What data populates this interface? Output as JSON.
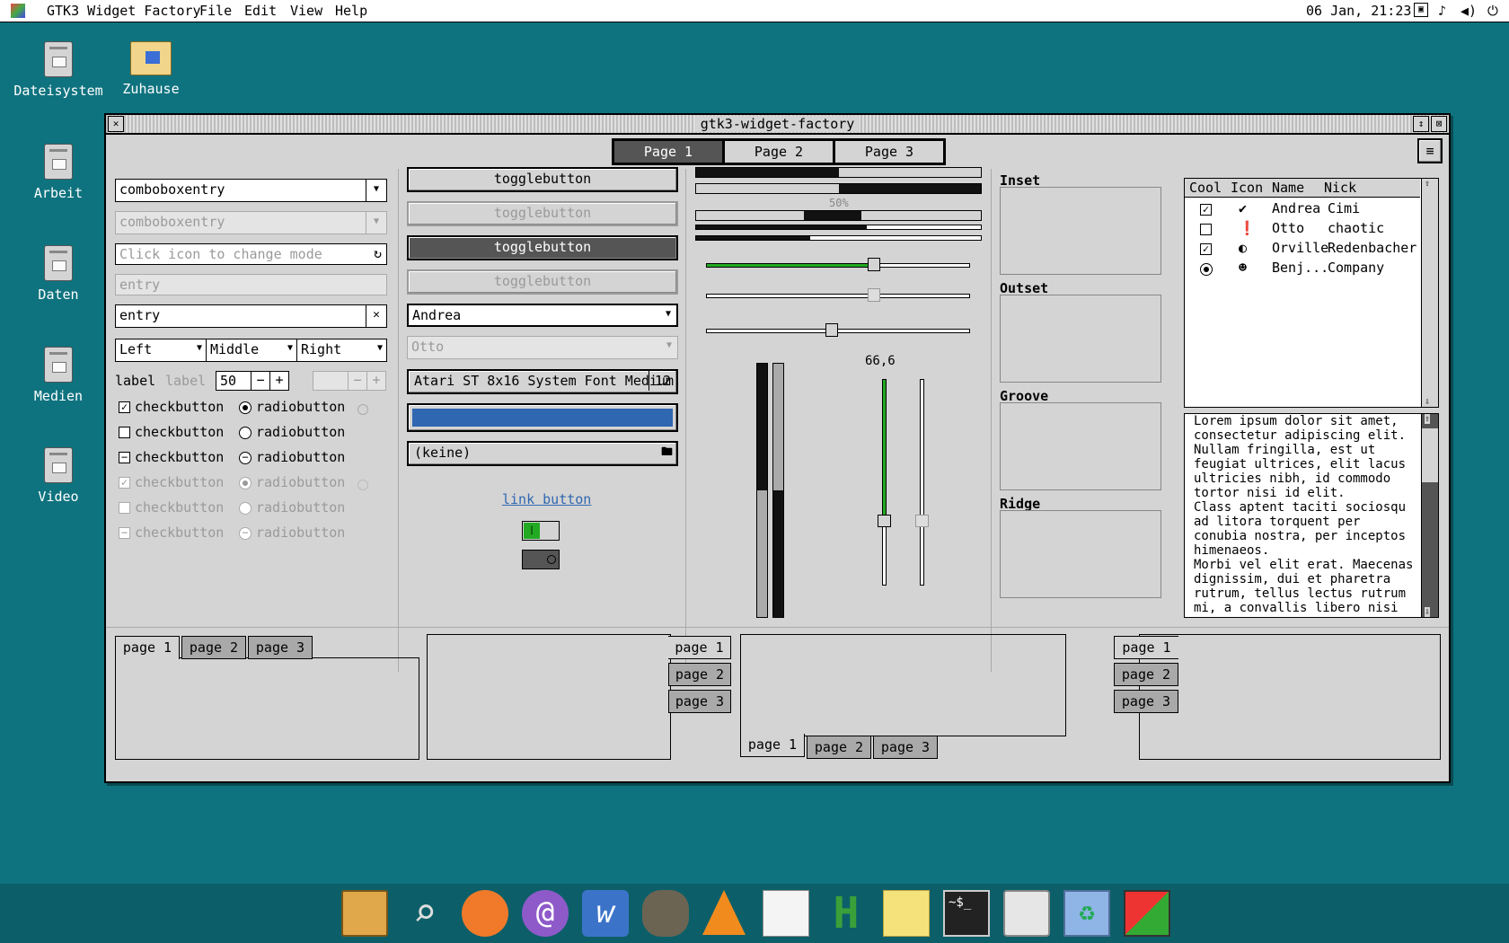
{
  "menubar": {
    "app_name": "GTK3 Widget Factory",
    "menus": [
      "File",
      "Edit",
      "View",
      "Help"
    ],
    "clock": "06 Jan, 21:23"
  },
  "desktop_icons": [
    "Dateisystem",
    "Zuhause",
    "Arbeit",
    "Daten",
    "Medien",
    "Video"
  ],
  "window": {
    "title": "gtk3-widget-factory",
    "page_tabs": [
      "Page 1",
      "Page 2",
      "Page 3"
    ],
    "col1": {
      "combo1": "comboboxentry",
      "combo2": "comboboxentry",
      "entry_icon_placeholder": "Click icon to change mode",
      "entry_disabled": "entry",
      "entry_clear": "entry",
      "seg": [
        "Left",
        "Middle",
        "Right"
      ],
      "label1": "label",
      "label2": "label",
      "spin_value": "50",
      "check_label": "checkbutton",
      "radio_label": "radiobutton"
    },
    "col2": {
      "toggle_label": "togglebutton",
      "combo_andrea": "Andrea",
      "combo_otto": "Otto",
      "font_button": "Atari ST 8x16 System Font Medium",
      "font_size": "12",
      "file_button": "(keine)",
      "link_button": "link button",
      "accent_color": "#2f67b0"
    },
    "col3": {
      "progress_label": "50%",
      "scale_value": "66,6",
      "green": "#22aa22"
    },
    "frames": [
      "Inset",
      "Outset",
      "Groove",
      "Ridge"
    ],
    "tree": {
      "headers": [
        "Cool",
        "Icon",
        "Name",
        "Nick"
      ],
      "rows": [
        {
          "cool": "check",
          "icon": "checkmark-icon",
          "name": "Andrea",
          "nick": "Cimi"
        },
        {
          "cool": "empty",
          "icon": "alert-icon",
          "name": "Otto",
          "nick": "chaotic"
        },
        {
          "cool": "check",
          "icon": "moon-icon",
          "name": "Orville",
          "nick": "Redenbacher"
        },
        {
          "cool": "radio",
          "icon": "person-icon",
          "name": "Benj...",
          "nick": "Company"
        }
      ]
    },
    "text_lines": [
      "Lorem ipsum dolor sit amet,",
      "consectetur adipiscing elit.",
      "Nullam fringilla, est ut",
      "feugiat ultrices, elit lacus",
      "ultricies nibh, id commodo",
      "tortor nisi id elit.",
      "Class aptent taciti sociosqu",
      "ad litora torquent per",
      "conubia nostra, per inceptos",
      "himenaeos.",
      "Morbi vel elit erat. Maecenas",
      "dignissim, dui et pharetra",
      "rutrum, tellus lectus rutrum",
      "mi, a convallis libero nisi"
    ],
    "notebooks": {
      "tabs": [
        "page 1",
        "page 2",
        "page 3"
      ]
    }
  },
  "dock_icons": [
    "archive-icon",
    "search-icon",
    "firefox-icon",
    "mail-icon",
    "writer-icon",
    "gimp-icon",
    "vlc-icon",
    "notes-icon",
    "hatari-icon",
    "sticky-icon",
    "terminal-icon",
    "panel-icon",
    "trash-icon",
    "cube-icon"
  ]
}
